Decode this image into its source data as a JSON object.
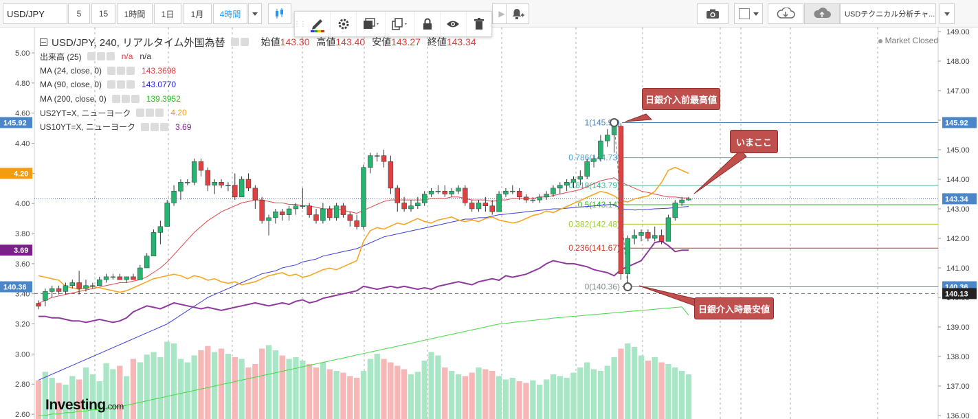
{
  "toolbar": {
    "symbol": "USD/JPY",
    "intervals": [
      "5",
      "15",
      "1時間",
      "1日",
      "1月",
      "4時間"
    ],
    "active_interval": "4時間",
    "layout_name": "USDテクニカル分析チャ..."
  },
  "float_toolbar": {
    "icons": [
      "pencil-icon",
      "gear-icon",
      "layers-icon",
      "copy-icon",
      "lock-icon",
      "eye-icon",
      "trash-icon"
    ]
  },
  "legend": {
    "title": "USD/JPY, 240, リアルタイム外国為替",
    "ohlc": [
      {
        "label": "始値",
        "value": "143.30"
      },
      {
        "label": "高値",
        "value": "143.40"
      },
      {
        "label": "安値",
        "value": "143.27"
      },
      {
        "label": "終値",
        "value": "143.34"
      }
    ],
    "indicators": [
      {
        "label": "出来高 (25)",
        "value": "n/a",
        "value2": "n/a",
        "color": "#e03b3b"
      },
      {
        "label": "MA (24, close, 0)",
        "value": "143.3698",
        "color": "#e03b3b"
      },
      {
        "label": "MA (90, close, 0)",
        "value": "143.0770",
        "color": "#2020e0"
      },
      {
        "label": "MA (200, close, 0)",
        "value": "139.3952",
        "color": "#19c419"
      },
      {
        "label": "US2YT=X, ニューヨーク",
        "value": "4.20",
        "color": "#f39c12"
      },
      {
        "label": "US10YT=X, ニューヨーク",
        "value": "3.69",
        "color": "#7b1f8a"
      }
    ],
    "market_status": "Market Closed"
  },
  "annotations": {
    "high_label": "日銀介入前最高値",
    "now_label": "いまここ",
    "low_label": "日銀介入時最安値"
  },
  "logo": {
    "main": "Investing",
    "suffix": ".com"
  },
  "chart_data": {
    "type": "line",
    "symbol": "USD/JPY",
    "interval": "240",
    "right_axis": {
      "ticks": [
        136,
        137,
        138,
        139,
        140,
        141,
        142,
        143,
        144,
        145,
        146,
        147,
        148,
        149
      ],
      "markers": [
        {
          "value": 145.92,
          "label": "145.92",
          "color": "#4a86c8"
        },
        {
          "value": 143.34,
          "label": "143.34",
          "color": "#4a86c8"
        },
        {
          "value": 140.36,
          "label": "140.36",
          "color": "#4a86c8"
        },
        {
          "value": 140.13,
          "label": "140.13",
          "color": "#222222"
        }
      ]
    },
    "left_axis": {
      "ticks": [
        2.6,
        2.8,
        3.0,
        3.2,
        3.4,
        3.6,
        3.8,
        4.0,
        4.2,
        4.4,
        4.6,
        4.8,
        5.0
      ],
      "markers": [
        {
          "value": 4.2,
          "label": "4.20",
          "color": "#f39c12"
        },
        {
          "value": 3.69,
          "label": "3.69",
          "color": "#7b1f8a"
        }
      ]
    },
    "fibonacci": [
      {
        "level": "1",
        "price": 145.92,
        "color": "#4a7fb0"
      },
      {
        "level": "0.786",
        "price": 144.73,
        "color": "#3fa3d8"
      },
      {
        "level": "0.618",
        "price": 143.79,
        "color": "#3cb89b"
      },
      {
        "level": "0.5",
        "price": 143.14,
        "color": "#2db82d"
      },
      {
        "level": "0.382",
        "price": 142.48,
        "color": "#9ccc28"
      },
      {
        "level": "0.236",
        "price": 141.67,
        "color": "#c0392b"
      },
      {
        "level": "0",
        "price": 140.36,
        "color": "#7f8c8d"
      }
    ],
    "candles": [
      [
        139.8,
        139.9,
        139.6,
        139.7
      ],
      [
        139.9,
        140.3,
        139.7,
        140.2
      ],
      [
        140.2,
        140.4,
        140.0,
        140.3
      ],
      [
        140.3,
        140.4,
        140.1,
        140.2
      ],
      [
        140.2,
        140.5,
        140.1,
        140.4
      ],
      [
        140.4,
        140.6,
        140.3,
        140.5
      ],
      [
        140.5,
        140.9,
        140.1,
        140.3
      ],
      [
        140.3,
        140.6,
        140.2,
        140.4
      ],
      [
        140.4,
        140.5,
        140.3,
        140.4
      ],
      [
        140.4,
        140.7,
        140.4,
        140.6
      ],
      [
        140.6,
        140.8,
        140.5,
        140.7
      ],
      [
        140.7,
        140.8,
        140.6,
        140.7
      ],
      [
        140.7,
        140.8,
        140.6,
        140.6
      ],
      [
        140.6,
        140.7,
        140.5,
        140.7
      ],
      [
        140.7,
        140.8,
        140.6,
        140.6
      ],
      [
        140.6,
        141.1,
        140.6,
        141.0
      ],
      [
        141.0,
        141.5,
        141.0,
        141.4
      ],
      [
        141.4,
        142.3,
        141.4,
        142.2
      ],
      [
        142.2,
        142.6,
        141.8,
        142.4
      ],
      [
        142.4,
        143.3,
        142.4,
        143.2
      ],
      [
        143.2,
        143.8,
        143.1,
        143.6
      ],
      [
        143.6,
        144.0,
        143.3,
        143.9
      ],
      [
        143.9,
        144.0,
        143.8,
        143.9
      ],
      [
        143.9,
        144.7,
        143.8,
        144.6
      ],
      [
        144.6,
        144.7,
        144.1,
        144.3
      ],
      [
        144.3,
        144.4,
        143.6,
        143.8
      ],
      [
        143.8,
        144.0,
        143.5,
        143.9
      ],
      [
        143.9,
        144.0,
        143.7,
        143.8
      ],
      [
        143.8,
        143.9,
        143.6,
        143.8
      ],
      [
        143.8,
        144.2,
        143.3,
        143.4
      ],
      [
        143.4,
        144.1,
        143.4,
        144.0
      ],
      [
        144.0,
        144.2,
        143.6,
        143.7
      ],
      [
        143.7,
        143.8,
        143.0,
        143.3
      ],
      [
        143.3,
        143.4,
        142.5,
        142.6
      ],
      [
        142.6,
        142.8,
        142.1,
        142.7
      ],
      [
        142.7,
        143.0,
        142.5,
        142.9
      ],
      [
        142.9,
        143.0,
        142.6,
        142.8
      ],
      [
        142.8,
        143.1,
        142.6,
        143.0
      ],
      [
        143.0,
        143.2,
        142.8,
        143.1
      ],
      [
        143.1,
        143.7,
        143.0,
        143.1
      ],
      [
        143.1,
        143.2,
        142.7,
        142.8
      ],
      [
        142.8,
        143.0,
        142.5,
        142.6
      ],
      [
        142.6,
        143.2,
        142.5,
        143.0
      ],
      [
        143.0,
        143.1,
        142.6,
        142.7
      ],
      [
        142.7,
        143.2,
        142.6,
        143.1
      ],
      [
        143.1,
        143.2,
        142.7,
        142.8
      ],
      [
        142.8,
        142.9,
        142.4,
        142.6
      ],
      [
        142.6,
        142.8,
        142.3,
        142.4
      ],
      [
        142.4,
        144.5,
        142.3,
        144.4
      ],
      [
        144.4,
        144.9,
        144.2,
        144.8
      ],
      [
        144.8,
        144.9,
        144.6,
        144.8
      ],
      [
        144.8,
        145.0,
        144.4,
        144.6
      ],
      [
        144.6,
        144.8,
        143.5,
        143.7
      ],
      [
        143.7,
        143.8,
        142.9,
        143.2
      ],
      [
        143.2,
        143.4,
        142.9,
        143.0
      ],
      [
        143.0,
        143.3,
        142.9,
        143.1
      ],
      [
        143.1,
        143.4,
        143.0,
        143.2
      ],
      [
        143.2,
        143.6,
        143.1,
        143.5
      ],
      [
        143.5,
        143.7,
        143.4,
        143.6
      ],
      [
        143.6,
        143.8,
        143.5,
        143.6
      ],
      [
        143.6,
        143.8,
        143.4,
        143.5
      ],
      [
        143.5,
        143.7,
        143.4,
        143.6
      ],
      [
        143.6,
        143.8,
        143.5,
        143.7
      ],
      [
        143.7,
        143.8,
        143.1,
        143.2
      ],
      [
        143.2,
        143.3,
        142.9,
        143.0
      ],
      [
        143.0,
        143.3,
        142.9,
        143.2
      ],
      [
        143.2,
        143.4,
        142.9,
        143.1
      ],
      [
        143.1,
        143.3,
        142.8,
        142.9
      ],
      [
        142.9,
        143.6,
        142.9,
        143.5
      ],
      [
        143.5,
        143.7,
        143.4,
        143.6
      ],
      [
        143.6,
        143.8,
        143.5,
        143.6
      ],
      [
        143.6,
        143.7,
        143.3,
        143.4
      ],
      [
        143.4,
        143.5,
        143.2,
        143.3
      ],
      [
        143.3,
        143.4,
        143.2,
        143.3
      ],
      [
        143.3,
        143.5,
        143.2,
        143.4
      ],
      [
        143.4,
        143.6,
        143.3,
        143.5
      ],
      [
        143.5,
        143.8,
        143.4,
        143.7
      ],
      [
        143.7,
        143.9,
        143.5,
        143.8
      ],
      [
        143.8,
        144.0,
        143.6,
        143.9
      ],
      [
        143.9,
        144.1,
        143.7,
        144.0
      ],
      [
        144.0,
        144.3,
        143.8,
        144.1
      ],
      [
        144.1,
        144.7,
        144.0,
        144.6
      ],
      [
        144.6,
        144.8,
        144.4,
        144.7
      ],
      [
        144.7,
        145.5,
        144.6,
        145.3
      ],
      [
        145.3,
        145.7,
        145.1,
        145.5
      ],
      [
        145.5,
        145.92,
        144.9,
        145.8
      ],
      [
        145.8,
        145.9,
        140.6,
        140.8
      ],
      [
        140.8,
        142.1,
        140.36,
        142.0
      ],
      [
        142.0,
        142.3,
        141.8,
        142.1
      ],
      [
        142.1,
        142.3,
        141.9,
        142.2
      ],
      [
        142.2,
        142.3,
        141.9,
        142.0
      ],
      [
        142.0,
        142.4,
        141.9,
        142.1
      ],
      [
        142.1,
        142.3,
        141.8,
        141.9
      ],
      [
        141.9,
        142.8,
        141.9,
        142.7
      ],
      [
        142.7,
        143.3,
        142.6,
        143.2
      ],
      [
        143.2,
        143.4,
        143.1,
        143.3
      ],
      [
        143.3,
        143.4,
        143.27,
        143.34
      ]
    ],
    "volume": [
      0.45,
      0.55,
      0.48,
      0.42,
      0.4,
      0.5,
      0.46,
      0.6,
      0.52,
      0.44,
      0.65,
      0.58,
      0.62,
      0.5,
      0.7,
      0.66,
      0.75,
      0.78,
      0.72,
      0.9,
      0.88,
      0.7,
      0.66,
      0.74,
      0.8,
      0.85,
      0.78,
      0.82,
      0.76,
      0.72,
      0.7,
      0.6,
      0.64,
      0.82,
      0.86,
      0.8,
      0.74,
      0.7,
      0.72,
      0.68,
      0.64,
      0.6,
      0.66,
      0.58,
      0.56,
      0.54,
      0.5,
      0.48,
      0.56,
      0.7,
      0.76,
      0.7,
      0.66,
      0.62,
      0.58,
      0.52,
      0.55,
      0.68,
      0.78,
      0.74,
      0.6,
      0.56,
      0.52,
      0.5,
      0.54,
      0.6,
      0.58,
      0.56,
      0.5,
      0.46,
      0.48,
      0.44,
      0.42,
      0.45,
      0.4,
      0.46,
      0.52,
      0.5,
      0.48,
      0.54,
      0.6,
      0.66,
      0.58,
      0.56,
      0.62,
      0.72,
      0.82,
      0.88,
      0.84,
      0.74,
      0.68,
      0.72,
      0.66,
      0.64,
      0.6,
      0.56,
      0.52
    ],
    "ma24": [
      139.8,
      139.9,
      140.0,
      140.05,
      140.1,
      140.15,
      140.2,
      140.25,
      140.3,
      140.35,
      140.4,
      140.45,
      140.5,
      140.5,
      140.55,
      140.6,
      140.7,
      140.85,
      141.0,
      141.2,
      141.45,
      141.7,
      141.95,
      142.2,
      142.4,
      142.6,
      142.75,
      142.9,
      143.0,
      143.1,
      143.2,
      143.25,
      143.3,
      143.3,
      143.25,
      143.2,
      143.2,
      143.15,
      143.15,
      143.1,
      143.1,
      143.05,
      143.0,
      143.0,
      143.0,
      142.95,
      142.9,
      142.85,
      142.95,
      143.05,
      143.15,
      143.25,
      143.3,
      143.3,
      143.3,
      143.3,
      143.3,
      143.3,
      143.35,
      143.35,
      143.35,
      143.4,
      143.4,
      143.35,
      143.3,
      143.3,
      143.3,
      143.25,
      143.3,
      143.3,
      143.35,
      143.35,
      143.35,
      143.35,
      143.4,
      143.4,
      143.45,
      143.5,
      143.55,
      143.6,
      143.65,
      143.75,
      143.85,
      143.95,
      144.0,
      144.05,
      143.9,
      143.8,
      143.7,
      143.6,
      143.55,
      143.5,
      143.45,
      143.4,
      143.4,
      143.37,
      143.37
    ],
    "ma90": [
      137.2,
      137.3,
      137.4,
      137.5,
      137.6,
      137.7,
      137.8,
      137.9,
      138.0,
      138.1,
      138.2,
      138.3,
      138.4,
      138.5,
      138.6,
      138.7,
      138.8,
      138.9,
      139.0,
      139.1,
      139.25,
      139.4,
      139.55,
      139.7,
      139.85,
      140.0,
      140.1,
      140.2,
      140.3,
      140.4,
      140.5,
      140.6,
      140.7,
      140.8,
      140.85,
      140.9,
      141.0,
      141.05,
      141.1,
      141.2,
      141.25,
      141.3,
      141.4,
      141.45,
      141.5,
      141.55,
      141.6,
      141.65,
      141.75,
      141.85,
      141.95,
      142.05,
      142.1,
      142.15,
      142.2,
      142.25,
      142.3,
      142.35,
      142.4,
      142.45,
      142.5,
      142.55,
      142.6,
      142.65,
      142.65,
      142.7,
      142.7,
      142.75,
      142.8,
      142.82,
      142.85,
      142.87,
      142.9,
      142.92,
      142.95,
      142.97,
      143.0,
      143.0,
      143.02,
      143.04,
      143.06,
      143.08,
      143.1,
      143.12,
      143.14,
      143.15,
      143.0,
      142.98,
      142.96,
      142.97,
      142.98,
      143.0,
      143.01,
      143.02,
      143.04,
      143.06,
      143.08
    ],
    "ma200": [
      136.0,
      136.0,
      136.05,
      136.05,
      136.1,
      136.1,
      136.15,
      136.15,
      136.2,
      136.2,
      136.25,
      136.3,
      136.3,
      136.35,
      136.4,
      136.45,
      136.5,
      136.55,
      136.6,
      136.65,
      136.7,
      136.75,
      136.8,
      136.85,
      136.9,
      136.95,
      137.0,
      137.05,
      137.1,
      137.15,
      137.2,
      137.25,
      137.3,
      137.35,
      137.4,
      137.45,
      137.5,
      137.55,
      137.6,
      137.65,
      137.7,
      137.75,
      137.8,
      137.85,
      137.9,
      137.95,
      138.0,
      138.05,
      138.1,
      138.15,
      138.2,
      138.25,
      138.3,
      138.35,
      138.4,
      138.45,
      138.5,
      138.55,
      138.6,
      138.65,
      138.7,
      138.75,
      138.8,
      138.85,
      138.9,
      138.95,
      139.0,
      139.05,
      139.1,
      139.12,
      139.15,
      139.18,
      139.2,
      139.22,
      139.25,
      139.27,
      139.3,
      139.32,
      139.34,
      139.36,
      139.38,
      139.4,
      139.42,
      139.44,
      139.46,
      139.48,
      139.5,
      139.52,
      139.54,
      139.56,
      139.58,
      139.6,
      139.62,
      139.64,
      139.66,
      139.68,
      139.4
    ],
    "us2y": [
      3.52,
      3.51,
      3.5,
      3.49,
      3.45,
      3.44,
      3.43,
      3.44,
      3.45,
      3.44,
      3.43,
      3.42,
      3.41,
      3.42,
      3.44,
      3.46,
      3.48,
      3.5,
      3.51,
      3.52,
      3.53,
      3.52,
      3.5,
      3.52,
      3.51,
      3.49,
      3.5,
      3.48,
      3.47,
      3.48,
      3.46,
      3.47,
      3.48,
      3.5,
      3.52,
      3.53,
      3.54,
      3.52,
      3.53,
      3.51,
      3.52,
      3.54,
      3.56,
      3.57,
      3.56,
      3.58,
      3.6,
      3.62,
      3.75,
      3.82,
      3.84,
      3.83,
      3.85,
      3.87,
      3.86,
      3.88,
      3.9,
      3.88,
      3.87,
      3.89,
      3.9,
      3.91,
      3.89,
      3.88,
      3.89,
      3.88,
      3.9,
      3.91,
      3.89,
      3.88,
      3.87,
      3.88,
      3.9,
      3.92,
      3.93,
      3.95,
      3.94,
      3.96,
      3.98,
      4.0,
      4.02,
      4.04,
      4.06,
      4.08,
      4.07,
      4.05,
      4.02,
      4.01,
      4.03,
      4.04,
      4.05,
      4.08,
      4.14,
      4.22,
      4.24,
      4.22,
      4.2
    ],
    "us10y": [
      3.25,
      3.25,
      3.24,
      3.24,
      3.23,
      3.22,
      3.22,
      3.21,
      3.22,
      3.23,
      3.22,
      3.21,
      3.22,
      3.24,
      3.28,
      3.3,
      3.32,
      3.31,
      3.3,
      3.32,
      3.34,
      3.33,
      3.32,
      3.31,
      3.3,
      3.31,
      3.3,
      3.29,
      3.3,
      3.31,
      3.32,
      3.33,
      3.34,
      3.33,
      3.32,
      3.33,
      3.34,
      3.33,
      3.35,
      3.36,
      3.34,
      3.35,
      3.37,
      3.38,
      3.39,
      3.4,
      3.41,
      3.42,
      3.45,
      3.44,
      3.43,
      3.44,
      3.45,
      3.44,
      3.45,
      3.44,
      3.43,
      3.44,
      3.43,
      3.45,
      3.46,
      3.47,
      3.48,
      3.47,
      3.46,
      3.48,
      3.49,
      3.5,
      3.49,
      3.52,
      3.51,
      3.52,
      3.53,
      3.55,
      3.57,
      3.6,
      3.62,
      3.61,
      3.6,
      3.6,
      3.59,
      3.58,
      3.56,
      3.55,
      3.54,
      3.52,
      3.56,
      3.58,
      3.6,
      3.62,
      3.68,
      3.74,
      3.75,
      3.72,
      3.68,
      3.69,
      3.69
    ]
  }
}
